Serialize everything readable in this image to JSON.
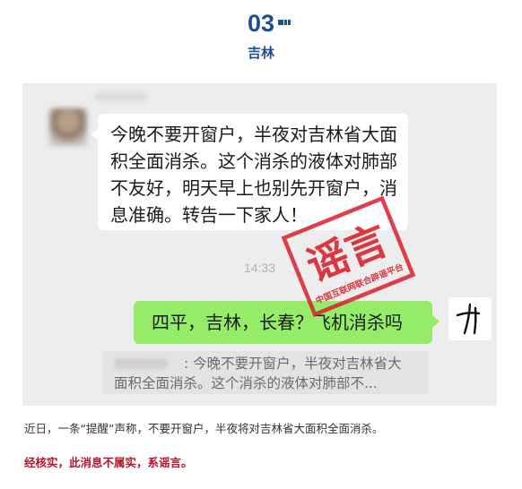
{
  "header": {
    "number": "03",
    "city": "吉林"
  },
  "chat": {
    "incoming_message": "今晚不要开窗户，半夜对吉林省大面积全面消杀。这个消杀的液体对肺部不友好，明天早上也别先开窗户，消息准确。转告一下家人！",
    "timestamp": "14:33",
    "outgoing_message": "四平，吉林，长春？飞机消杀吗",
    "quote": {
      "separator": ":",
      "line1": "今晚不要开窗户，半夜对吉林省大",
      "line2": "面积全面消杀。这个消杀的液体对肺部不..."
    }
  },
  "stamp": {
    "main_text": "谣言",
    "sub_text": "中国互联网联合辟谣平台",
    "color": "#d81e2c"
  },
  "caption": "近日，一条“提醒”声称，不要开窗户，半夜将对吉林省大面积全面消杀。",
  "verdict": "经核实，此消息不属实，系谣言。",
  "colors": {
    "accent": "#1f4e91",
    "bubble_out": "#95ec69",
    "verdict": "#b8142a"
  }
}
